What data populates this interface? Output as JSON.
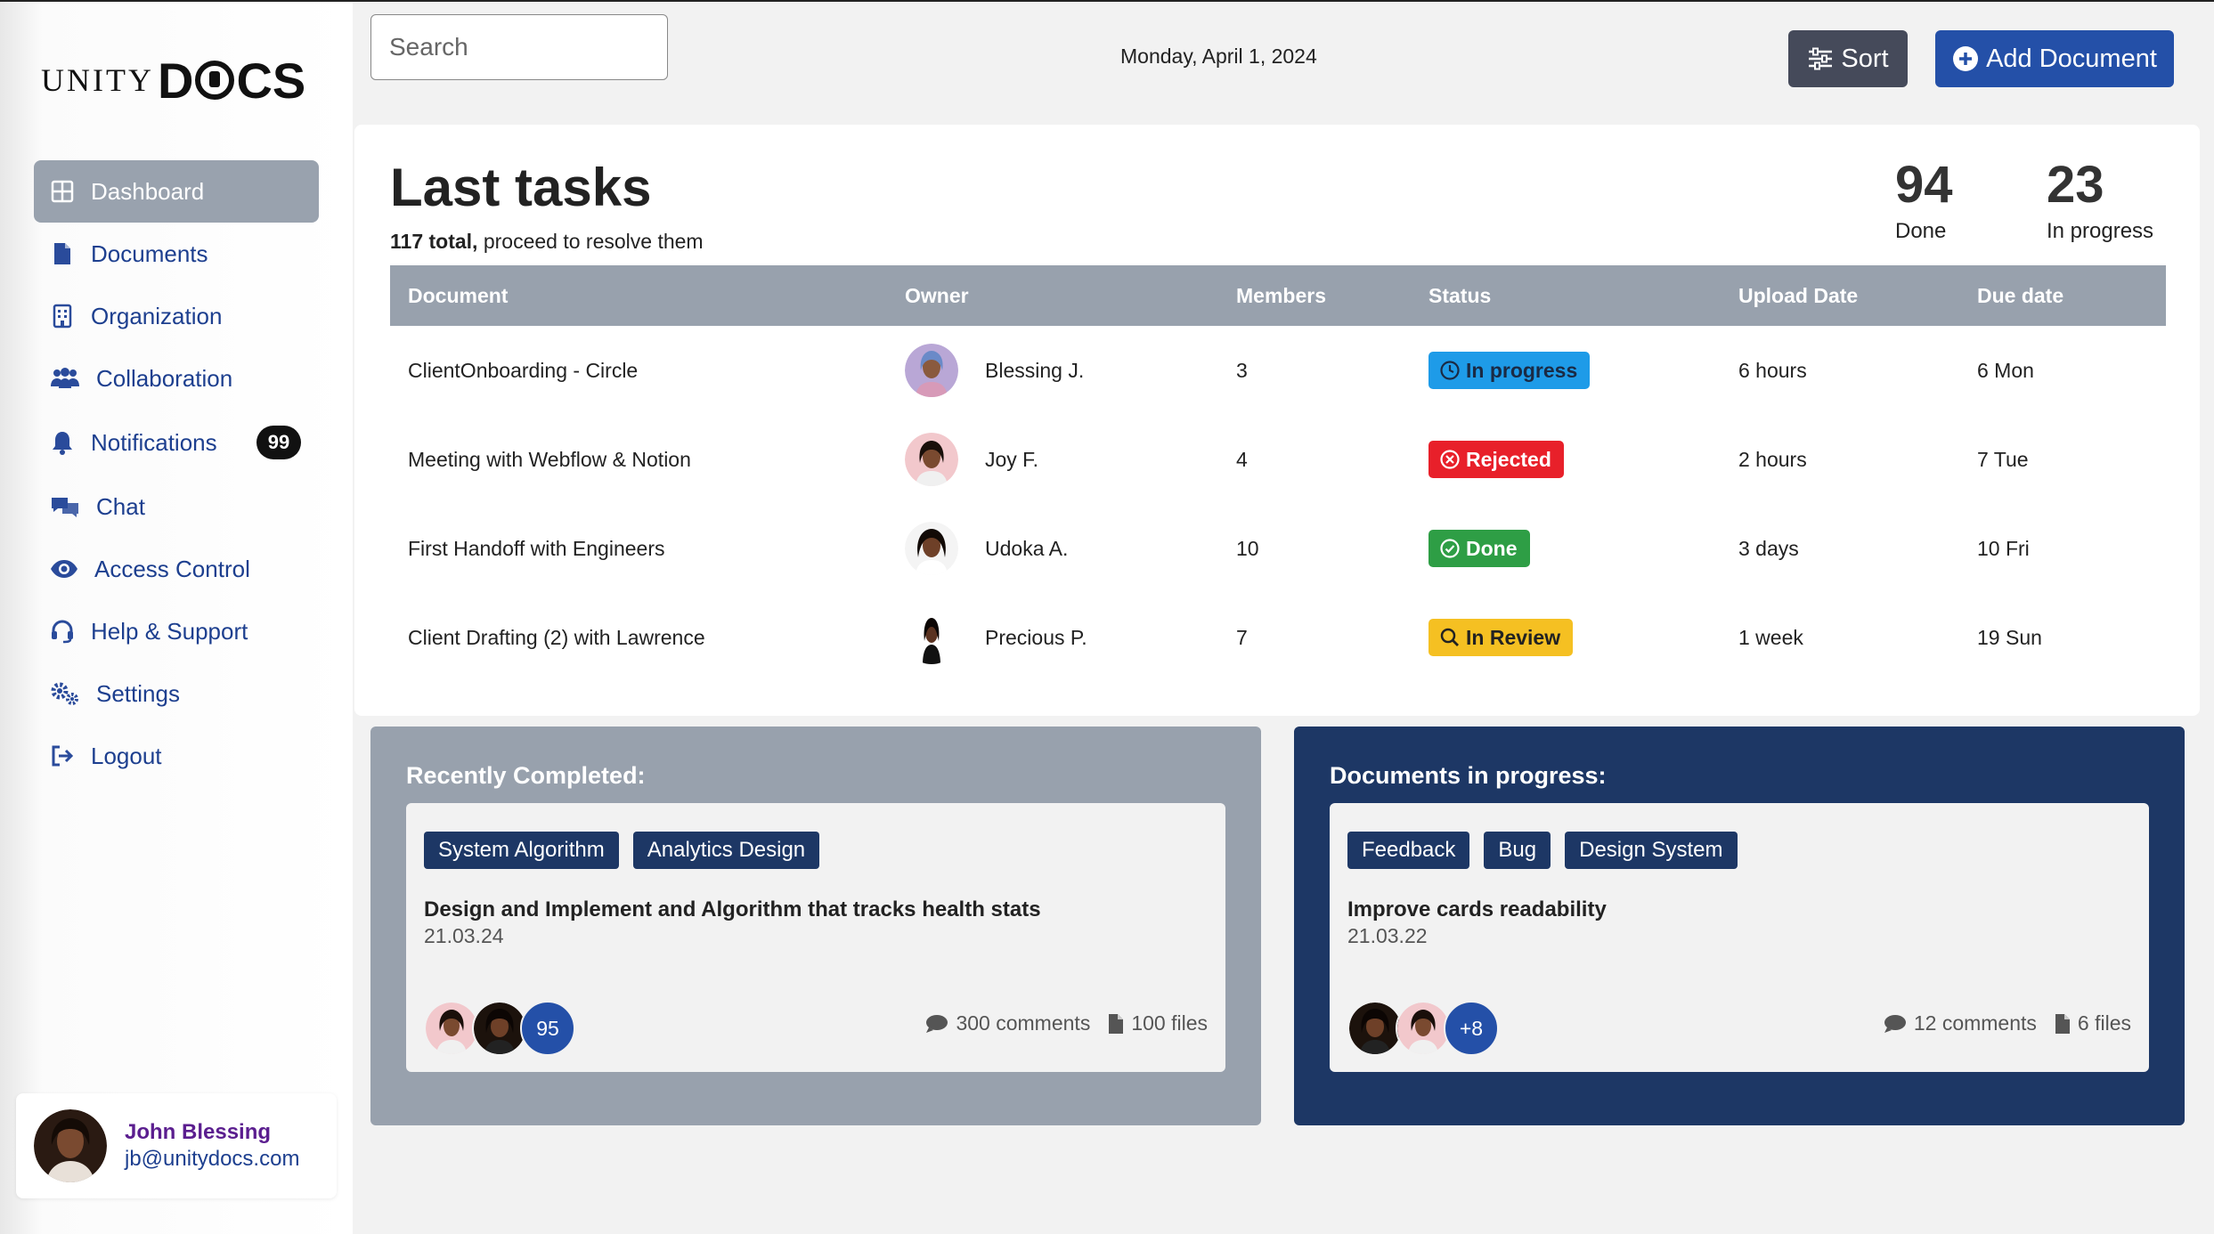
{
  "brand": {
    "logo_left": "UNITY",
    "logo_right": "DOCS"
  },
  "sidebar": {
    "items": [
      {
        "label": "Dashboard",
        "icon": "grid-icon",
        "active": true
      },
      {
        "label": "Documents",
        "icon": "file-icon"
      },
      {
        "label": "Organization",
        "icon": "building-icon"
      },
      {
        "label": "Collaboration",
        "icon": "users-icon"
      },
      {
        "label": "Notifications",
        "icon": "bell-icon",
        "badge": "99"
      },
      {
        "label": "Chat",
        "icon": "chat-icon"
      },
      {
        "label": "Access Control",
        "icon": "eye-icon"
      },
      {
        "label": "Help & Support",
        "icon": "headset-icon"
      },
      {
        "label": "Settings",
        "icon": "gears-icon"
      },
      {
        "label": "Logout",
        "icon": "logout-icon"
      }
    ]
  },
  "user": {
    "name": "John Blessing",
    "email": "jb@unitydocs.com"
  },
  "topbar": {
    "search_placeholder": "Search",
    "date": "Monday, April 1, 2024",
    "sort_label": "Sort",
    "add_label": "Add Document"
  },
  "tasks": {
    "title": "Last tasks",
    "total_bold": "117 total,",
    "total_rest": " proceed to resolve them",
    "stats": {
      "done_value": "94",
      "done_label": "Done",
      "progress_value": "23",
      "progress_label": "In progress"
    },
    "columns": [
      "Document",
      "Owner",
      "Members",
      "Status",
      "Upload Date",
      "Due date"
    ],
    "rows": [
      {
        "document": "ClientOnboarding - Circle",
        "owner": "Blessing J.",
        "members": "3",
        "status": "In progress",
        "upload": "6 hours",
        "due": "6 Mon"
      },
      {
        "document": "Meeting with Webflow & Notion",
        "owner": "Joy F.",
        "members": "4",
        "status": "Rejected",
        "upload": "2 hours",
        "due": "7 Tue"
      },
      {
        "document": "First Handoff with Engineers",
        "owner": "Udoka A.",
        "members": "10",
        "status": "Done",
        "upload": "3 days",
        "due": "10 Fri"
      },
      {
        "document": "Client Drafting (2) with Lawrence",
        "owner": "Precious P.",
        "members": "7",
        "status": "In Review",
        "upload": "1 week",
        "due": "19 Sun"
      }
    ]
  },
  "status_colors": {
    "In progress": "#1e9be8",
    "Rejected": "#e8202a",
    "Done": "#2e9e45",
    "In Review": "#f5c022"
  },
  "recently_completed": {
    "title": "Recently Completed:",
    "tags": [
      "System Algorithm",
      "Analytics Design"
    ],
    "item_title": "Design and Implement and Algorithm that tracks health stats",
    "item_date": "21.03.24",
    "avatar_count": "95",
    "comments": "300 comments",
    "files": "100 files"
  },
  "in_progress": {
    "title": "Documents in progress:",
    "tags": [
      "Feedback",
      "Bug",
      "Design System"
    ],
    "item_title": "Improve cards readability",
    "item_date": "21.03.22",
    "avatar_count": "+8",
    "comments": "12 comments",
    "files": "6 files"
  }
}
